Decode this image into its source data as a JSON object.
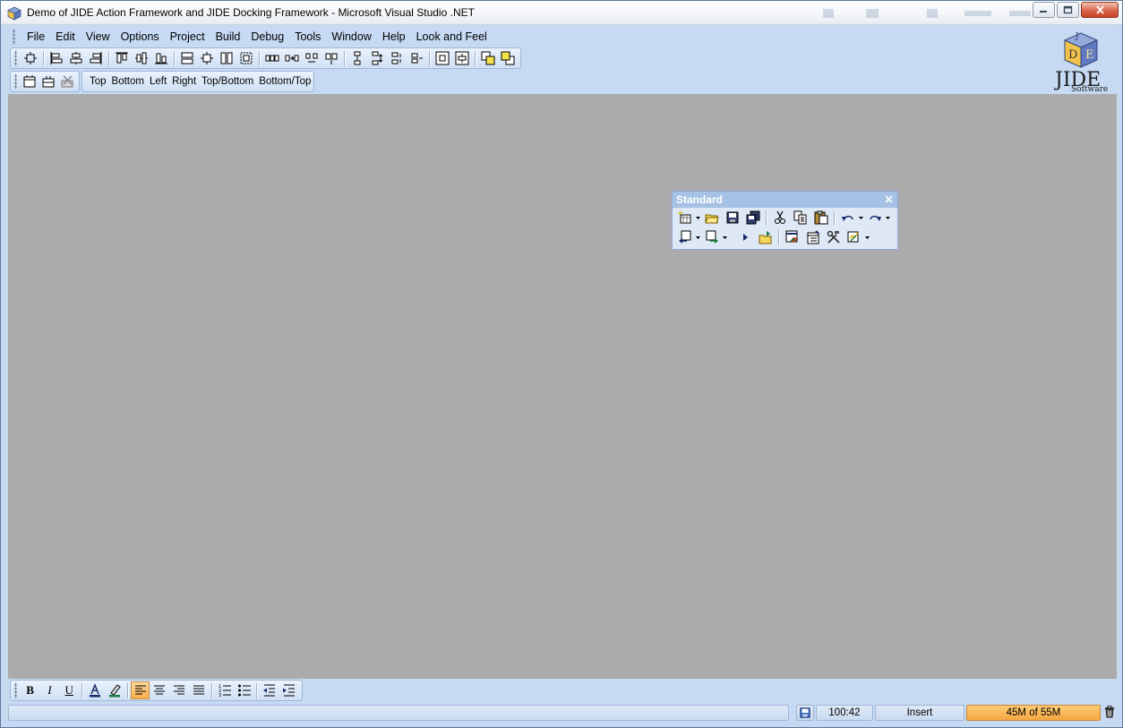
{
  "window": {
    "title": "Demo of JIDE Action Framework and JIDE Docking Framework - Microsoft Visual Studio .NET"
  },
  "menu": [
    "File",
    "Edit",
    "View",
    "Options",
    "Project",
    "Build",
    "Debug",
    "Tools",
    "Window",
    "Help",
    "Look and Feel"
  ],
  "orientation_toolbar": {
    "labels": [
      "Top",
      "Bottom",
      "Left",
      "Right",
      "Top/Bottom",
      "Bottom/Top"
    ]
  },
  "logo": {
    "text": "JIDE",
    "subtext": "Software",
    "cube_letters": [
      "J",
      "D",
      "E"
    ]
  },
  "floating_toolbar": {
    "title": "Standard"
  },
  "format_toolbar": {
    "bold": "B",
    "italic": "I",
    "underline": "U"
  },
  "statusbar": {
    "position": "100:42",
    "mode": "Insert",
    "memory": "45M of 55M"
  },
  "colors": {
    "workspace": "#ababab",
    "chrome": "#c6daf3",
    "accent_orange": "#f9b04e"
  }
}
